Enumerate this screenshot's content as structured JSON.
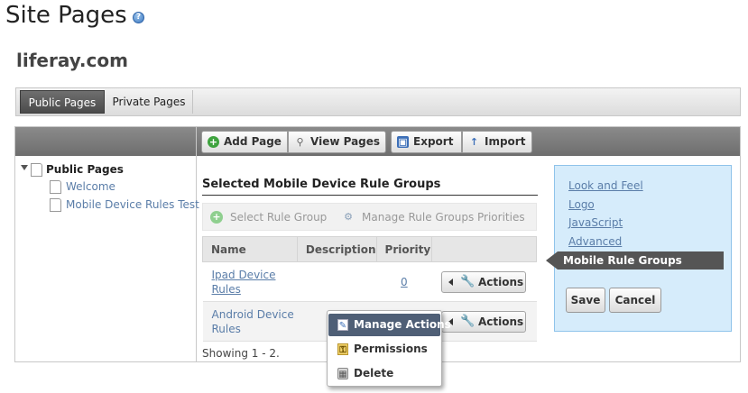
{
  "page": {
    "title": "Site Pages",
    "help_icon": "question-icon",
    "site_name": "liferay.com"
  },
  "tabs": [
    {
      "label": "Public Pages",
      "selected": true
    },
    {
      "label": "Private Pages",
      "selected": false
    }
  ],
  "toolbar": {
    "add_page": "Add Page",
    "view_pages": "View Pages",
    "export": "Export",
    "import": "Import",
    "icons": [
      "plus-icon",
      "magnifier-icon",
      "disk-icon",
      "up-arrow-icon"
    ]
  },
  "tree": {
    "root": "Public Pages",
    "items": [
      "Welcome",
      "Mobile Device Rules Test"
    ]
  },
  "rule_groups": {
    "title": "Selected Mobile Device Rule Groups",
    "select_label": "Select Rule Group",
    "manage_priorities_label": "Manage Rule Groups Priorities",
    "columns": [
      "Name",
      "Description",
      "Priority",
      ""
    ],
    "rows": [
      {
        "name_line1": "Ipad Device",
        "name_line2": "Rules",
        "description": "",
        "priority": "0",
        "action": "Actions"
      },
      {
        "name_line1": "Android Device",
        "name_line2": "Rules",
        "description": "",
        "priority": "",
        "action": "Actions"
      }
    ],
    "showing": "Showing 1 - 2."
  },
  "nav_panel": {
    "links": [
      "Look and Feel",
      "Logo",
      "JavaScript",
      "Advanced"
    ],
    "selected": "Mobile Rule Groups",
    "save": "Save",
    "cancel": "Cancel"
  },
  "actions_menu": {
    "items": [
      {
        "label": "Manage Actions",
        "icon": "manage-icon",
        "highlighted": true
      },
      {
        "label": "Permissions",
        "icon": "key-icon",
        "highlighted": false
      },
      {
        "label": "Delete",
        "icon": "trash-icon",
        "highlighted": false
      }
    ]
  },
  "colors": {
    "accent_link": "#5a7da8",
    "toolbar": "#7a7a7a",
    "nav_panel_bg": "#d6ecfb",
    "selected_tab": "#555555"
  }
}
